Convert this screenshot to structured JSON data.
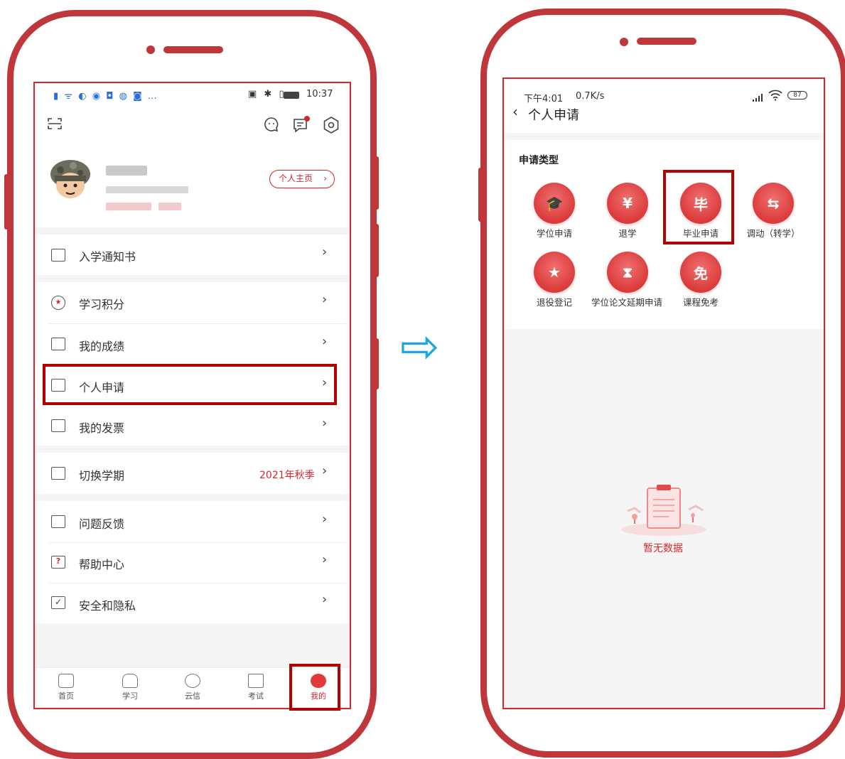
{
  "left_screen": {
    "status_bar": {
      "left_icons": "▮ ᯤ ◐ ◉ ◘ ◍ ◙ …",
      "right_icons": "▣ ✱ ▯",
      "time": "10:37"
    },
    "profile": {
      "homepage_button": "个人主页"
    },
    "menu": [
      {
        "label": "入学通知书"
      },
      {
        "label": "学习积分"
      },
      {
        "label": "我的成绩"
      },
      {
        "label": "个人申请"
      },
      {
        "label": "我的发票"
      },
      {
        "label": "切换学期",
        "value": "2021年秋季"
      },
      {
        "label": "问题反馈"
      },
      {
        "label": "帮助中心"
      },
      {
        "label": "安全和隐私"
      }
    ],
    "tabs": [
      {
        "label": "首页"
      },
      {
        "label": "学习"
      },
      {
        "label": "云信"
      },
      {
        "label": "考试"
      },
      {
        "label": "我的"
      }
    ],
    "colors": {
      "accent": "#d9262c",
      "highlight": "#b30000",
      "frame": "#c0373b"
    }
  },
  "right_screen": {
    "status_bar": {
      "time": "下午4:01",
      "speed": "0.7K/s",
      "battery": "87"
    },
    "header": {
      "back": "‹",
      "title": "个人申请"
    },
    "section_title": "申请类型",
    "apps": [
      {
        "label": "学位申请",
        "glyph": "🎓"
      },
      {
        "label": "退学",
        "glyph": "¥"
      },
      {
        "label": "毕业申请",
        "glyph": "毕"
      },
      {
        "label": "调动（转学）",
        "glyph": "⇆"
      },
      {
        "label": "退役登记",
        "glyph": "★"
      },
      {
        "label": "学位论文延期申请",
        "glyph": "⧗"
      },
      {
        "label": "课程免考",
        "glyph": "免"
      }
    ],
    "empty_text": "暂无数据"
  },
  "arrow": "⇨"
}
